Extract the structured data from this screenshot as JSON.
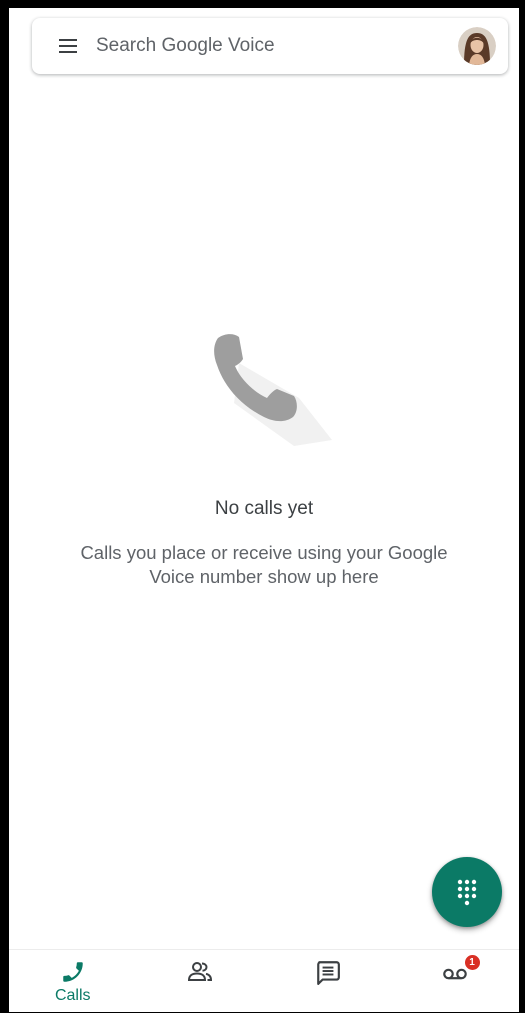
{
  "search": {
    "placeholder": "Search Google Voice"
  },
  "empty_state": {
    "title": "No calls yet",
    "description": "Calls you place or receive using your Google Voice number show up here"
  },
  "bottom_nav": {
    "calls_label": "Calls",
    "voicemail_badge": "1"
  },
  "colors": {
    "accent": "#0b7a66",
    "badge": "#d93025",
    "illustration": "#9e9e9e"
  },
  "icons": {
    "menu": "menu-icon",
    "avatar": "avatar",
    "empty": "phone-icon",
    "fab": "dialpad-icon",
    "nav": [
      "phone-icon",
      "contacts-icon",
      "message-icon",
      "voicemail-icon"
    ]
  }
}
